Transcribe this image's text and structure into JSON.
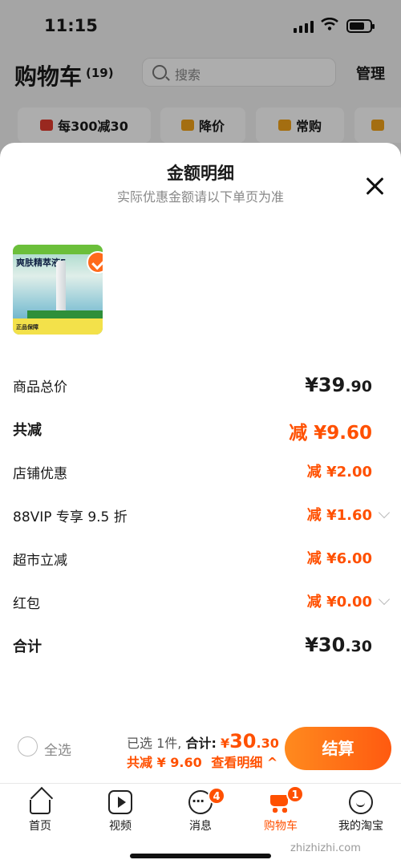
{
  "status_bar": {
    "time": "11:15"
  },
  "header": {
    "title": "购物车",
    "count": "(19)",
    "search_placeholder": "搜索",
    "manage": "管理"
  },
  "chips": [
    {
      "label": "每300减30",
      "icon": "coupon-icon"
    },
    {
      "label": "降价",
      "icon": "price-down-icon"
    },
    {
      "label": "常购",
      "icon": "cart-icon"
    },
    {
      "label": "",
      "icon": "folder-icon"
    }
  ],
  "sheet": {
    "title": "金额明细",
    "subtitle": "实际优惠金额请以下单页为准",
    "product": {
      "image_title": "爽肤精萃液5",
      "badge": "正品保障"
    },
    "rows": [
      {
        "label": "商品总价",
        "value_main": "¥39",
        "value_dec": ".90"
      },
      {
        "label": "共减",
        "value": "减 ¥9.60"
      },
      {
        "label": "店铺优惠",
        "value": "减 ¥2.00"
      },
      {
        "label": "88VIP 专享 9.5 折",
        "value": "减 ¥1.60"
      },
      {
        "label": "超市立减",
        "value": "减 ¥6.00"
      },
      {
        "label": "红包",
        "value": "减 ¥0.00"
      },
      {
        "label": "合计",
        "value_main": "¥30",
        "value_dec": ".30"
      }
    ]
  },
  "checkout_bar": {
    "select_all": "全选",
    "selected": "已选 1件,",
    "total_label": "合计:",
    "total_currency": "¥",
    "total_int": "30",
    "total_dec": ".30",
    "discount": "共减 ¥ 9.60",
    "details": "查看明细 ^",
    "button": "结算"
  },
  "tabbar": [
    {
      "label": "首页",
      "badge": ""
    },
    {
      "label": "视频",
      "badge": ""
    },
    {
      "label": "消息",
      "badge": "4"
    },
    {
      "label": "购物车",
      "badge": "1"
    },
    {
      "label": "我的淘宝",
      "badge": ""
    }
  ],
  "watermark": "zhizhizhi.com",
  "colors": {
    "accent": "#ff5000",
    "button_gradient_start": "#ff8a1e",
    "button_gradient_end": "#ff5a10"
  }
}
